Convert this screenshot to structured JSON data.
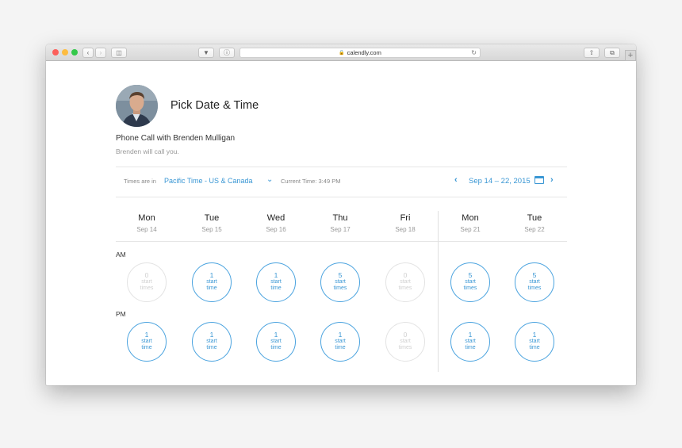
{
  "browser": {
    "url": "calendly.com",
    "colors": {
      "close": "#fc605b",
      "minimize": "#fdbc40",
      "zoom": "#34c84a"
    }
  },
  "page": {
    "title": "Pick Date & Time",
    "event_name": "Phone Call with Brenden Mulligan",
    "event_desc": "Brenden will call you."
  },
  "timezone": {
    "label": "Times are in",
    "value": "Pacific Time - US & Canada",
    "current_time": "Current Time: 3:49 PM"
  },
  "range": {
    "label": "Sep 14 – 22, 2015"
  },
  "days": [
    {
      "name": "Mon",
      "date": "Sep 14"
    },
    {
      "name": "Tue",
      "date": "Sep 15"
    },
    {
      "name": "Wed",
      "date": "Sep 16"
    },
    {
      "name": "Thu",
      "date": "Sep 17"
    },
    {
      "name": "Fri",
      "date": "Sep 18"
    },
    {
      "name": "Mon",
      "date": "Sep 21"
    },
    {
      "name": "Tue",
      "date": "Sep 22"
    }
  ],
  "sections": {
    "am": "AM",
    "pm": "PM"
  },
  "slots": {
    "am": [
      {
        "count": "0",
        "l1": "start",
        "l2": "times",
        "available": false
      },
      {
        "count": "1",
        "l1": "start",
        "l2": "time",
        "available": true
      },
      {
        "count": "1",
        "l1": "start",
        "l2": "time",
        "available": true
      },
      {
        "count": "5",
        "l1": "start",
        "l2": "times",
        "available": true
      },
      {
        "count": "0",
        "l1": "start",
        "l2": "times",
        "available": false
      },
      {
        "count": "5",
        "l1": "start",
        "l2": "times",
        "available": true
      },
      {
        "count": "5",
        "l1": "start",
        "l2": "times",
        "available": true
      }
    ],
    "pm": [
      {
        "count": "1",
        "l1": "start",
        "l2": "time",
        "available": true
      },
      {
        "count": "1",
        "l1": "start",
        "l2": "time",
        "available": true
      },
      {
        "count": "1",
        "l1": "start",
        "l2": "time",
        "available": true
      },
      {
        "count": "1",
        "l1": "start",
        "l2": "time",
        "available": true
      },
      {
        "count": "0",
        "l1": "start",
        "l2": "times",
        "available": false
      },
      {
        "count": "1",
        "l1": "start",
        "l2": "time",
        "available": true
      },
      {
        "count": "1",
        "l1": "start",
        "l2": "time",
        "available": true
      }
    ]
  },
  "accent": "#3a97d4"
}
